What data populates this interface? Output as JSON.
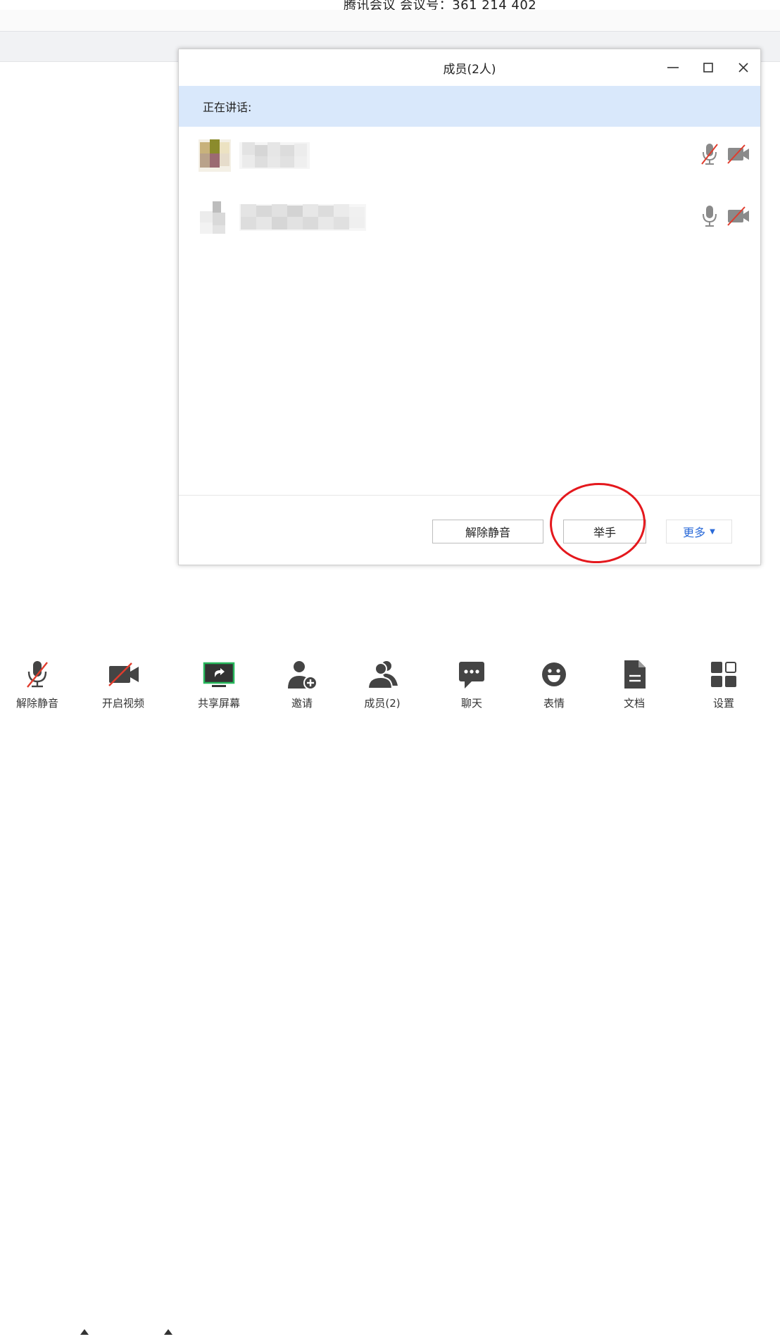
{
  "window": {
    "title": "腾讯会议 会议号：361 214 402"
  },
  "members_dialog": {
    "title": "成员(2人)",
    "speaking_label": "正在讲话:",
    "members": [
      {
        "name_visible": false,
        "mic": "muted",
        "camera": "off"
      },
      {
        "name_visible": false,
        "mic": "on",
        "camera": "off"
      }
    ],
    "buttons": {
      "unmute": "解除静音",
      "raise_hand": "举手",
      "more": "更多"
    }
  },
  "toolbar": {
    "items": [
      {
        "label": "解除静音",
        "icon": "mic-muted-icon"
      },
      {
        "label": "开启视频",
        "icon": "video-off-icon"
      },
      {
        "label": "共享屏幕",
        "icon": "share-screen-icon"
      },
      {
        "label": "邀请",
        "icon": "invite-icon"
      },
      {
        "label": "成员(2)",
        "icon": "members-icon"
      },
      {
        "label": "聊天",
        "icon": "chat-icon"
      },
      {
        "label": "表情",
        "icon": "emoji-icon"
      },
      {
        "label": "文档",
        "icon": "document-icon"
      },
      {
        "label": "设置",
        "icon": "settings-icon"
      }
    ]
  },
  "colors": {
    "accent_blue": "#2a6ad8",
    "highlight_bar": "#d9e8fb",
    "annotation_red": "#e4181d",
    "share_green": "#27b85c"
  }
}
